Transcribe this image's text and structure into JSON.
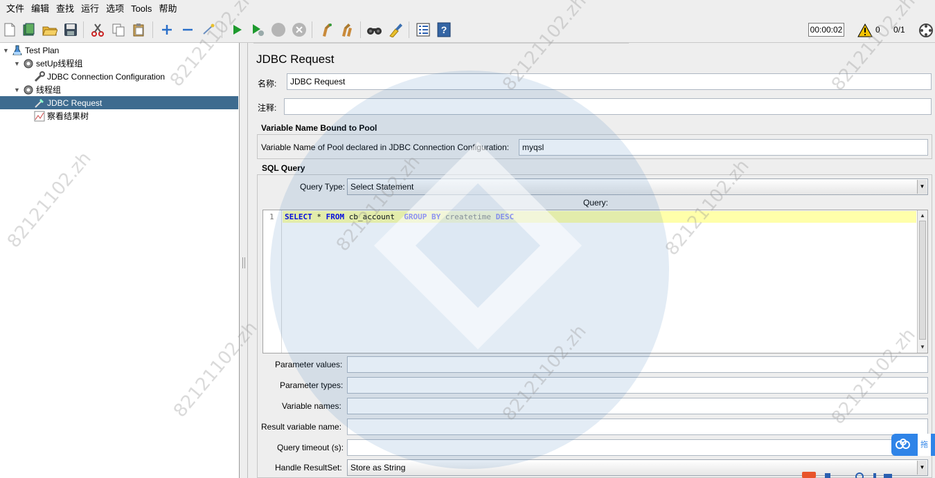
{
  "menu": [
    "文件",
    "编辑",
    "查找",
    "运行",
    "选项",
    "Tools",
    "帮助"
  ],
  "toolbar": {
    "timer": "00:00:02",
    "warning_count": "0",
    "thread_count": "0/1",
    "icons": [
      "new-icon",
      "templates-icon",
      "open-icon",
      "save-icon",
      "cut-icon",
      "copy-icon",
      "paste-icon",
      "expand-icon",
      "collapse-icon",
      "toggle-icon",
      "start-icon",
      "start-no-pause-icon",
      "stop-icon",
      "shutdown-icon",
      "clear-icon",
      "clear-all-icon",
      "search-icon",
      "reset-search-icon",
      "function-helper-icon",
      "help-icon",
      "warning-icon",
      "remote-icon"
    ]
  },
  "tree": {
    "items": [
      {
        "label": "Test Plan",
        "icon": "test-plan-icon"
      },
      {
        "label": "setUp线程组",
        "icon": "gear-icon"
      },
      {
        "label": "JDBC Connection Configuration",
        "icon": "wrench-icon"
      },
      {
        "label": "线程组",
        "icon": "gear-icon"
      },
      {
        "label": "JDBC Request",
        "icon": "pipette-icon"
      },
      {
        "label": "察看结果树",
        "icon": "graph-icon"
      }
    ]
  },
  "form": {
    "title": "JDBC Request",
    "name_label": "名称:",
    "name_value": "JDBC Request",
    "comment_label": "注释:",
    "comment_value": "",
    "pool_group_title": "Variable Name Bound to Pool",
    "pool_label": "Variable Name of Pool declared in JDBC Connection Configuration:",
    "pool_value": "myqsl",
    "sql_group_title": "SQL Query",
    "query_type_label": "Query Type:",
    "query_type_value": "Select Statement",
    "query_label": "Query:",
    "line_number": "1",
    "sql": {
      "select": "SELECT",
      "star": " * ",
      "from": "FROM",
      "table": " cb_account  ",
      "group_by": "GROUP BY",
      "column": " createtime ",
      "desc": "DESC"
    },
    "params": [
      {
        "label": "Parameter values:",
        "value": ""
      },
      {
        "label": "Parameter types:",
        "value": ""
      },
      {
        "label": "Variable names:",
        "value": ""
      },
      {
        "label": "Result variable name:",
        "value": ""
      },
      {
        "label": "Query timeout (s):",
        "value": ""
      }
    ],
    "handle_resultset_label": "Handle ResultSet:",
    "handle_resultset_value": "Store as String"
  },
  "watermark": "82121102.zh",
  "side_widget_label": "拖"
}
